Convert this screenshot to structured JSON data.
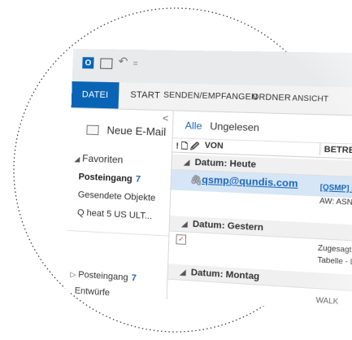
{
  "titlebar": {
    "app_icon": "outlook-icon",
    "app_icon_letter": "O",
    "undo_glyph": "↶",
    "qat_more_glyph": "="
  },
  "ribbon": {
    "tabs": [
      "DATEI",
      "START",
      "SENDEN/EMPFANGEN",
      "ORDNER",
      "ANSICHT"
    ],
    "active_tab_color": "#0a64b5"
  },
  "nav": {
    "collapse_glyph": "<",
    "new_mail_label": "Neue E-Mail",
    "favorites_label": "Favoriten",
    "favorites": [
      {
        "label": "Posteingang",
        "count": "7"
      },
      {
        "label": "Gesendete Objekte"
      },
      {
        "label": "Q heat 5 US ULT..."
      }
    ],
    "tree": [
      {
        "label": "Posteingang",
        "count": "7"
      },
      {
        "label": "Entwürfe"
      }
    ]
  },
  "mail": {
    "filters": {
      "all": "Alle",
      "unread": "Ungelesen"
    },
    "columns": {
      "flags": "! 🗋 🖉",
      "from": "VON",
      "subject": "BETREFF"
    },
    "groups": [
      "Datum: Heute",
      "Datum: Gestern",
      "Datum: Montag"
    ],
    "rows": [
      {
        "from": "qsmp@qundis.com",
        "subject": "[QSMP] Rea",
        "preview": "AW: ASN Ban"
      },
      {
        "from": "",
        "subject": "Zugesagt: G",
        "preview": "Tabelle - L"
      },
      {
        "from": "",
        "subject": "WALK"
      }
    ],
    "accent_color": "#1b67b8",
    "selected_row_color": "#d7e6f6"
  }
}
